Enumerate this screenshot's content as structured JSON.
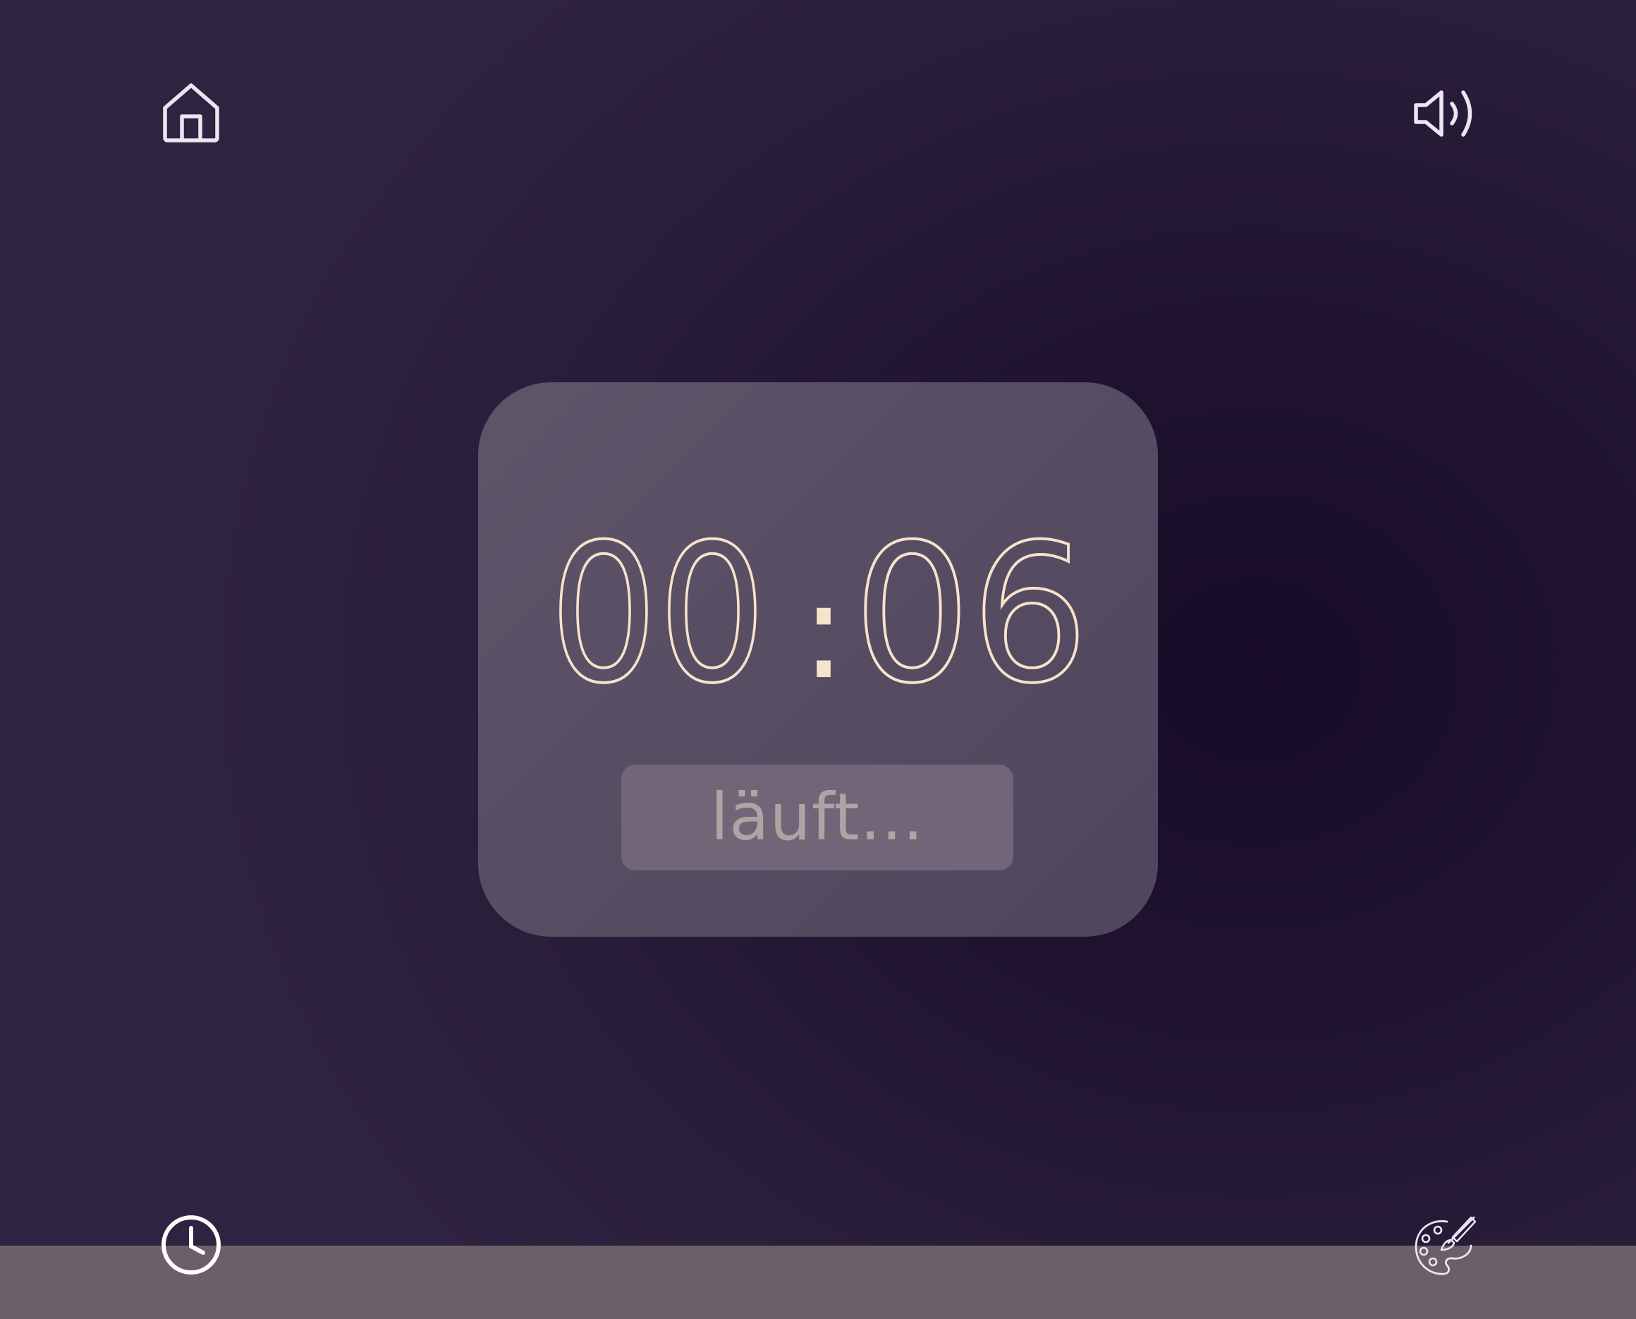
{
  "timer": {
    "minutes": "00",
    "seconds": "06",
    "separator": ":",
    "status_label": "läuft..."
  },
  "icons": {
    "top_left": "home-icon",
    "top_right": "volume-icon",
    "bottom_left": "clock-icon",
    "bottom_right": "palette-icon"
  },
  "colors": {
    "background": "#1f132f",
    "card": "#574d63",
    "digits": "#f6e3cc",
    "status_text": "#b1a3a4",
    "status_pill": "#706678",
    "bottom_bar": "#6c5f69",
    "icons": "#ede6f1"
  }
}
